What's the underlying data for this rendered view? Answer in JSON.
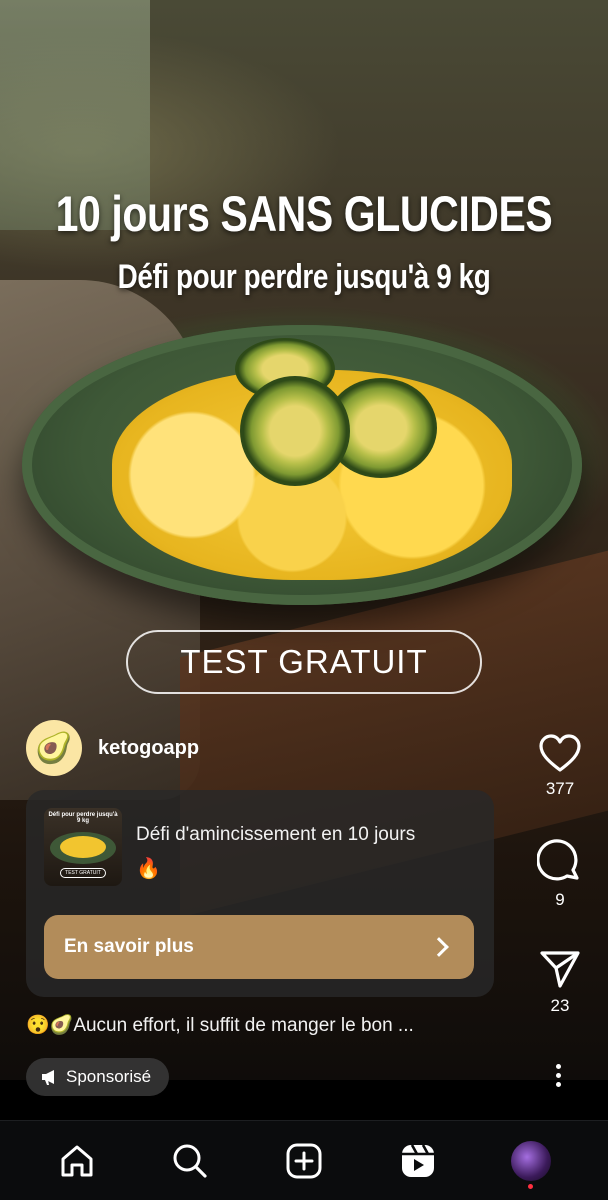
{
  "post": {
    "headline": "10 jours SANS GLUCIDES",
    "subheadline": "Défi pour perdre jusqu'à 9 kg",
    "cta_overlay": "TEST GRATUIT"
  },
  "author": {
    "avatar_emoji": "🥑",
    "handle": "ketogoapp"
  },
  "ad_card": {
    "thumbnail_text": "Défi pour perdre jusqu'à 9 kg",
    "thumbnail_cta": "TEST GRATUIT",
    "title": "Défi d'amincissement en 10 jours",
    "title_emoji": "🔥",
    "button_label": "En savoir plus"
  },
  "caption": "😯🥑Aucun effort, il suffit de manger le bon ...",
  "sponsored_label": "Sponsorisé",
  "actions": {
    "likes": "377",
    "comments": "9",
    "shares": "23"
  },
  "icons": {
    "like": "heart-icon",
    "comment": "comment-icon",
    "share": "send-icon",
    "more": "more-vertical-icon",
    "nav": [
      "home-icon",
      "search-icon",
      "create-icon",
      "reels-icon",
      "profile-avatar"
    ]
  },
  "colors": {
    "button_bg": "#b28c5a",
    "card_bg": "#282828",
    "nav_bg": "#0b0c0d",
    "notification_dot": "#ff3040"
  }
}
